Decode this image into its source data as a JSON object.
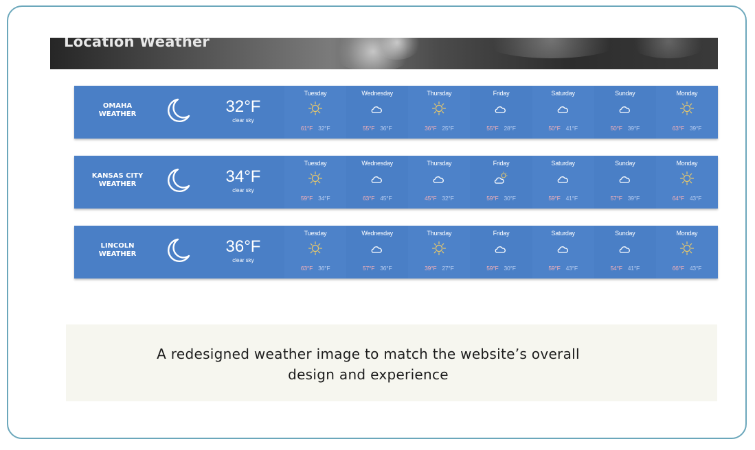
{
  "banner": {
    "title": "Location Weather"
  },
  "cities": [
    {
      "name": "OMAHA",
      "suffix": "WEATHER",
      "current_icon": "moon-icon",
      "temp": "32°F",
      "condition": "clear sky",
      "days": [
        {
          "name": "Tuesday",
          "icon": "sun-icon",
          "hi": "61°F",
          "lo": "32°F"
        },
        {
          "name": "Wednesday",
          "icon": "cloud-icon",
          "hi": "55°F",
          "lo": "36°F"
        },
        {
          "name": "Thursday",
          "icon": "sun-icon",
          "hi": "36°F",
          "lo": "25°F"
        },
        {
          "name": "Friday",
          "icon": "cloud-icon",
          "hi": "55°F",
          "lo": "28°F"
        },
        {
          "name": "Saturday",
          "icon": "cloud-icon",
          "hi": "50°F",
          "lo": "41°F"
        },
        {
          "name": "Sunday",
          "icon": "cloud-icon",
          "hi": "50°F",
          "lo": "39°F"
        },
        {
          "name": "Monday",
          "icon": "sun-icon",
          "hi": "63°F",
          "lo": "39°F"
        }
      ]
    },
    {
      "name": "KANSAS CITY",
      "suffix": "WEATHER",
      "current_icon": "moon-icon",
      "temp": "34°F",
      "condition": "clear sky",
      "days": [
        {
          "name": "Tuesday",
          "icon": "sun-icon",
          "hi": "59°F",
          "lo": "34°F"
        },
        {
          "name": "Wednesday",
          "icon": "cloud-icon",
          "hi": "63°F",
          "lo": "45°F"
        },
        {
          "name": "Thursday",
          "icon": "cloud-icon",
          "hi": "45°F",
          "lo": "32°F"
        },
        {
          "name": "Friday",
          "icon": "partly-cloudy-icon",
          "hi": "59°F",
          "lo": "30°F"
        },
        {
          "name": "Saturday",
          "icon": "cloud-icon",
          "hi": "59°F",
          "lo": "41°F"
        },
        {
          "name": "Sunday",
          "icon": "cloud-icon",
          "hi": "57°F",
          "lo": "39°F"
        },
        {
          "name": "Monday",
          "icon": "sun-icon",
          "hi": "64°F",
          "lo": "43°F"
        }
      ]
    },
    {
      "name": "LINCOLN",
      "suffix": "WEATHER",
      "current_icon": "moon-icon",
      "temp": "36°F",
      "condition": "clear sky",
      "days": [
        {
          "name": "Tuesday",
          "icon": "sun-icon",
          "hi": "63°F",
          "lo": "36°F"
        },
        {
          "name": "Wednesday",
          "icon": "cloud-icon",
          "hi": "57°F",
          "lo": "36°F"
        },
        {
          "name": "Thursday",
          "icon": "sun-icon",
          "hi": "39°F",
          "lo": "27°F"
        },
        {
          "name": "Friday",
          "icon": "cloud-icon",
          "hi": "59°F",
          "lo": "30°F"
        },
        {
          "name": "Saturday",
          "icon": "cloud-icon",
          "hi": "59°F",
          "lo": "43°F"
        },
        {
          "name": "Sunday",
          "icon": "cloud-icon",
          "hi": "54°F",
          "lo": "41°F"
        },
        {
          "name": "Monday",
          "icon": "sun-icon",
          "hi": "66°F",
          "lo": "43°F"
        }
      ]
    }
  ],
  "caption": {
    "line1": "A redesigned weather image to match the website’s overall",
    "line2": "design and experience"
  },
  "colors": {
    "strip_bg": "#4a7fc6",
    "sun": "#e8c86a",
    "hi_temp": "#f3b0b8",
    "lo_temp": "#b8cdf0",
    "frame_border": "#6ba7bb",
    "caption_bg": "#f6f6ef"
  }
}
